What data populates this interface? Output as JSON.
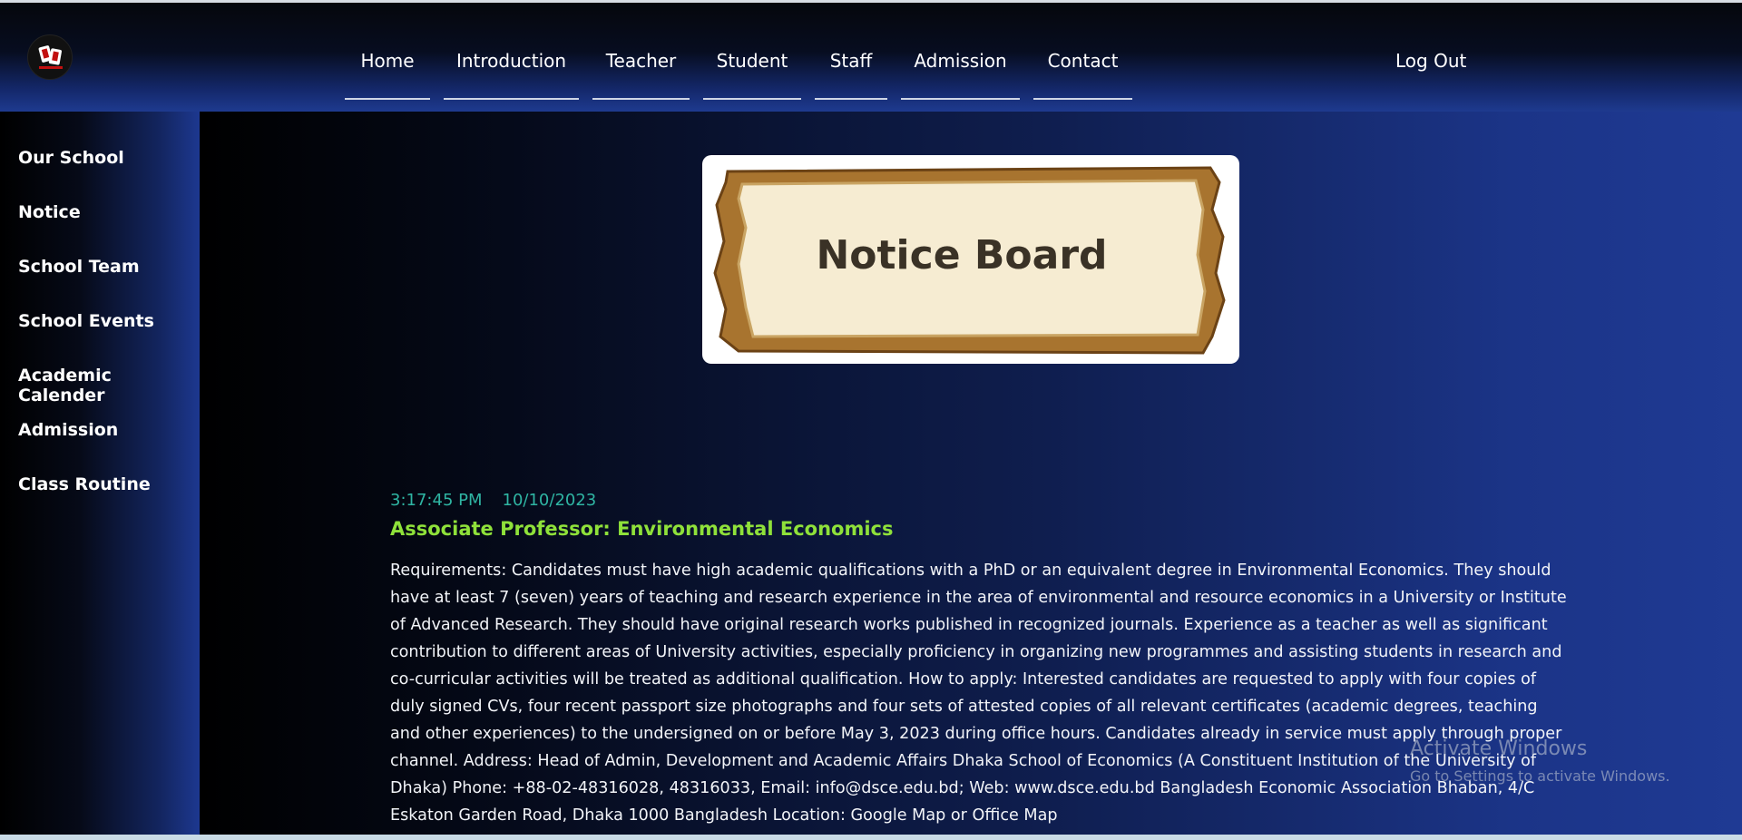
{
  "nav": {
    "items": [
      {
        "label": "Home"
      },
      {
        "label": "Introduction"
      },
      {
        "label": "Teacher"
      },
      {
        "label": "Student"
      },
      {
        "label": "Staff"
      },
      {
        "label": "Admission"
      },
      {
        "label": "Contact"
      }
    ],
    "logout": "Log Out",
    "logo_icon": "school-logo-icon"
  },
  "sidebar": {
    "items": [
      {
        "label": "Our School"
      },
      {
        "label": "Notice"
      },
      {
        "label": "School Team"
      },
      {
        "label": "School Events"
      },
      {
        "label": "Academic Calender"
      },
      {
        "label": "Admission"
      },
      {
        "label": "Class Routine"
      }
    ]
  },
  "banner": {
    "text": "Notice Board"
  },
  "notice": {
    "time": "3:17:45 PM",
    "date": "10/10/2023",
    "title": "Associate Professor: Environmental Economics",
    "body": "Requirements: Candidates must have high academic qualifications with a PhD or an equivalent degree in Environmental Economics. They should have at least 7 (seven) years of teaching and research experience in the area of environmental and resource economics in a University or Institute of Advanced Research. They should have original research works published in recognized journals. Experience as a teacher as well as significant contribution to different areas of University activities, especially proficiency in organizing new programmes and assisting students in research and co-curricular activities will be treated as additional qualification. How to apply: Interested candidates are requested to apply with four copies of duly signed CVs, four recent passport size photographs and four sets of attested copies of all relevant certificates (academic degrees, teaching and other experiences) to the undersigned on or before May 3, 2023 during office hours. Candidates already in service must apply through proper channel. Address: Head of Admin, Development and Academic Affairs Dhaka School of Economics (A Constituent Institution of the University of Dhaka) Phone: +88-02-48316028, 48316033, Email: info@dsce.edu.bd; Web: www.dsce.edu.bd Bangladesh Economic Association Bhaban, 4/C Eskaton Garden Road, Dhaka 1000 Bangladesh Location: Google Map or Office Map"
  },
  "watermark": {
    "line1": "Activate Windows",
    "line2": "Go to Settings to activate Windows."
  },
  "colors": {
    "accent_title": "#8fe13a",
    "meta_teal": "#2fb5a3",
    "header_blue": "#1e3a8f"
  }
}
